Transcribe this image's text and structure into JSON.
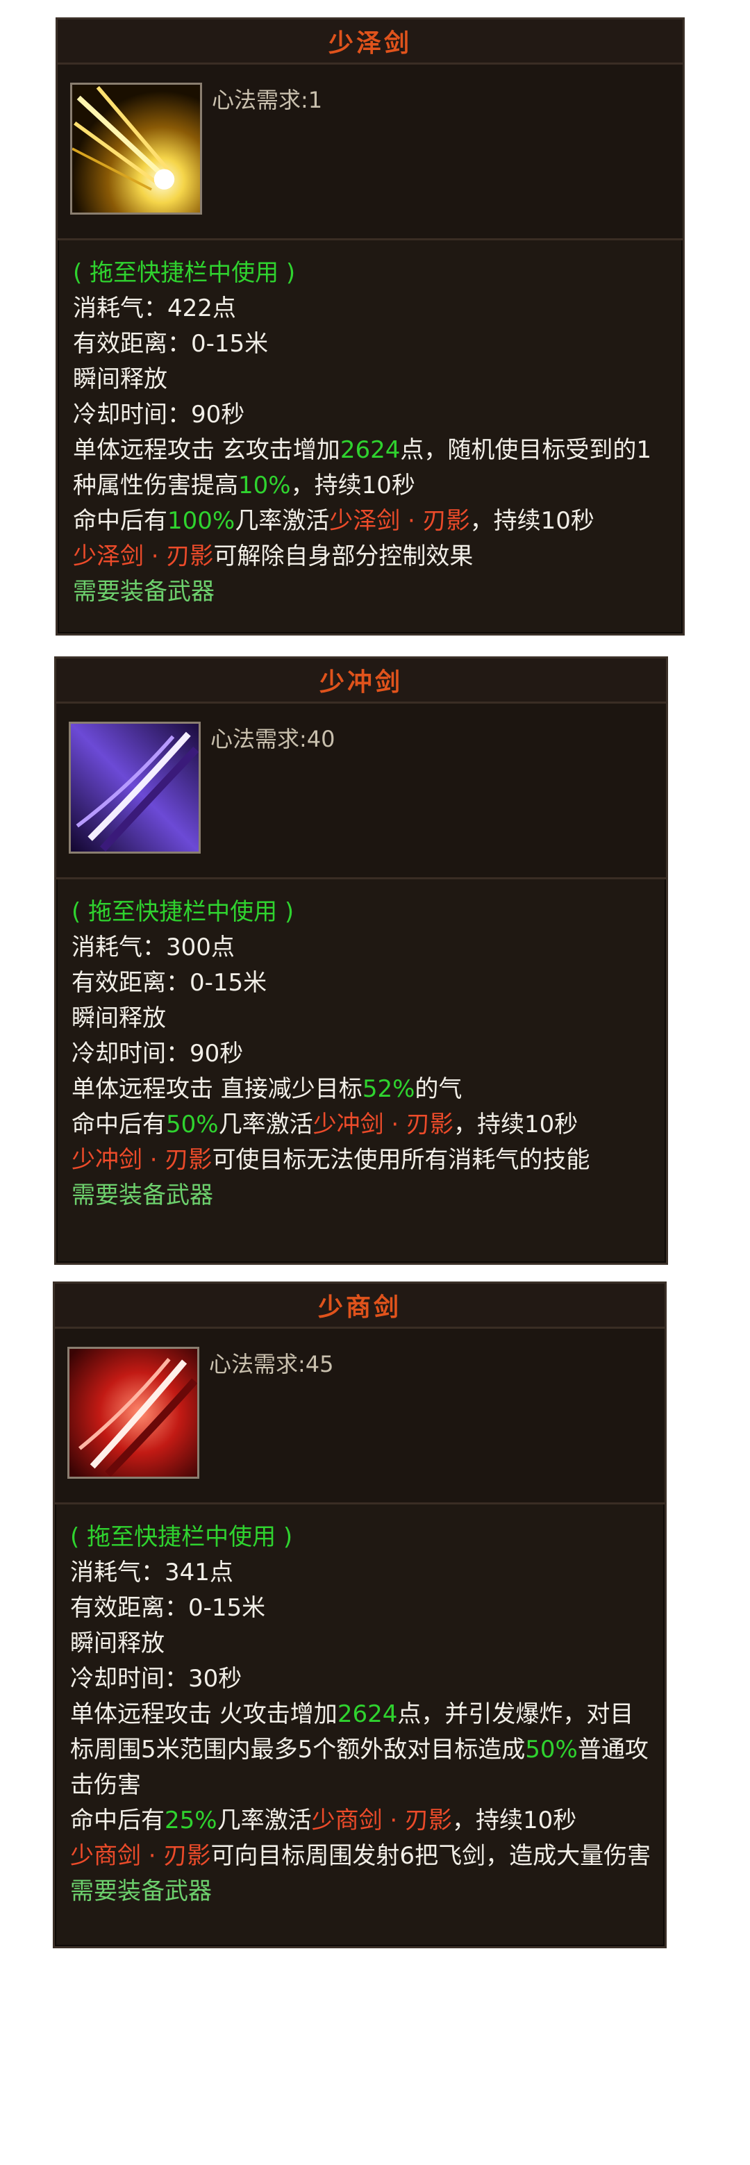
{
  "cards": [
    {
      "title": "少泽剑",
      "requirement": "心法需求:1",
      "drag_hint": "( 拖至快捷栏中使用 )",
      "qi": "消耗气：422点",
      "range": "有效距离：0-15米",
      "cast": "瞬间释放",
      "cooldown": "冷却时间：90秒",
      "desc_a": "单体远程攻击 玄攻击增加",
      "desc_b": "2624",
      "desc_c": "点，随机使目标受到的1种属性伤害提高",
      "desc_d": "10%",
      "desc_e": "，持续10秒",
      "proc_a": "命中后有",
      "proc_b": "100%",
      "proc_c": "几率激活",
      "proc_d": "少泽剑 · 刃影",
      "proc_e": "，持续10秒",
      "effect_a": "少泽剑 · 刃影",
      "effect_b": "可解除自身部分控制效果",
      "weapon": "需要装备武器",
      "icon": "golden-sword-burst-icon",
      "icon_colors": [
        "#f5d54a",
        "#5a3a00"
      ]
    },
    {
      "title": "少冲剑",
      "requirement": "心法需求:40",
      "drag_hint": "( 拖至快捷栏中使用 )",
      "qi": "消耗气：300点",
      "range": "有效距离：0-15米",
      "cast": "瞬间释放",
      "cooldown": "冷却时间：90秒",
      "desc_a": "单体远程攻击 直接减少目标",
      "desc_b": "52%",
      "desc_c": "的气",
      "proc_a": "命中后有",
      "proc_b": "50%",
      "proc_c": "几率激活",
      "proc_d": "少冲剑 · 刃影",
      "proc_e": "，持续10秒",
      "effect_a": "少冲剑 · 刃影",
      "effect_b": "可使目标无法使用所有消耗气的技能",
      "weapon": "需要装备武器",
      "icon": "purple-sword-slash-icon",
      "icon_colors": [
        "#c9b3ff",
        "#2a1458"
      ]
    },
    {
      "title": "少商剑",
      "requirement": "心法需求:45",
      "drag_hint": "( 拖至快捷栏中使用 )",
      "qi": "消耗气：341点",
      "range": "有效距离：0-15米",
      "cast": "瞬间释放",
      "cooldown": "冷却时间：30秒",
      "desc_a": "单体远程攻击 火攻击增加",
      "desc_b": "2624",
      "desc_c": "点，并引发爆炸，对目标周围5米范围内最多5个额外敌对目标造成",
      "desc_d": "50%",
      "desc_e": "普通攻击伤害",
      "proc_a": "命中后有",
      "proc_b": "25%",
      "proc_c": "几率激活",
      "proc_d": "少商剑 · 刃影",
      "proc_e": "，持续10秒",
      "effect_a": "少商剑 · 刃影",
      "effect_b": "可向目标周围发射6把飞剑，造成大量伤害",
      "weapon": "需要装备武器",
      "icon": "red-sword-slash-icon",
      "icon_colors": [
        "#ff9a86",
        "#5a0a08"
      ]
    }
  ]
}
